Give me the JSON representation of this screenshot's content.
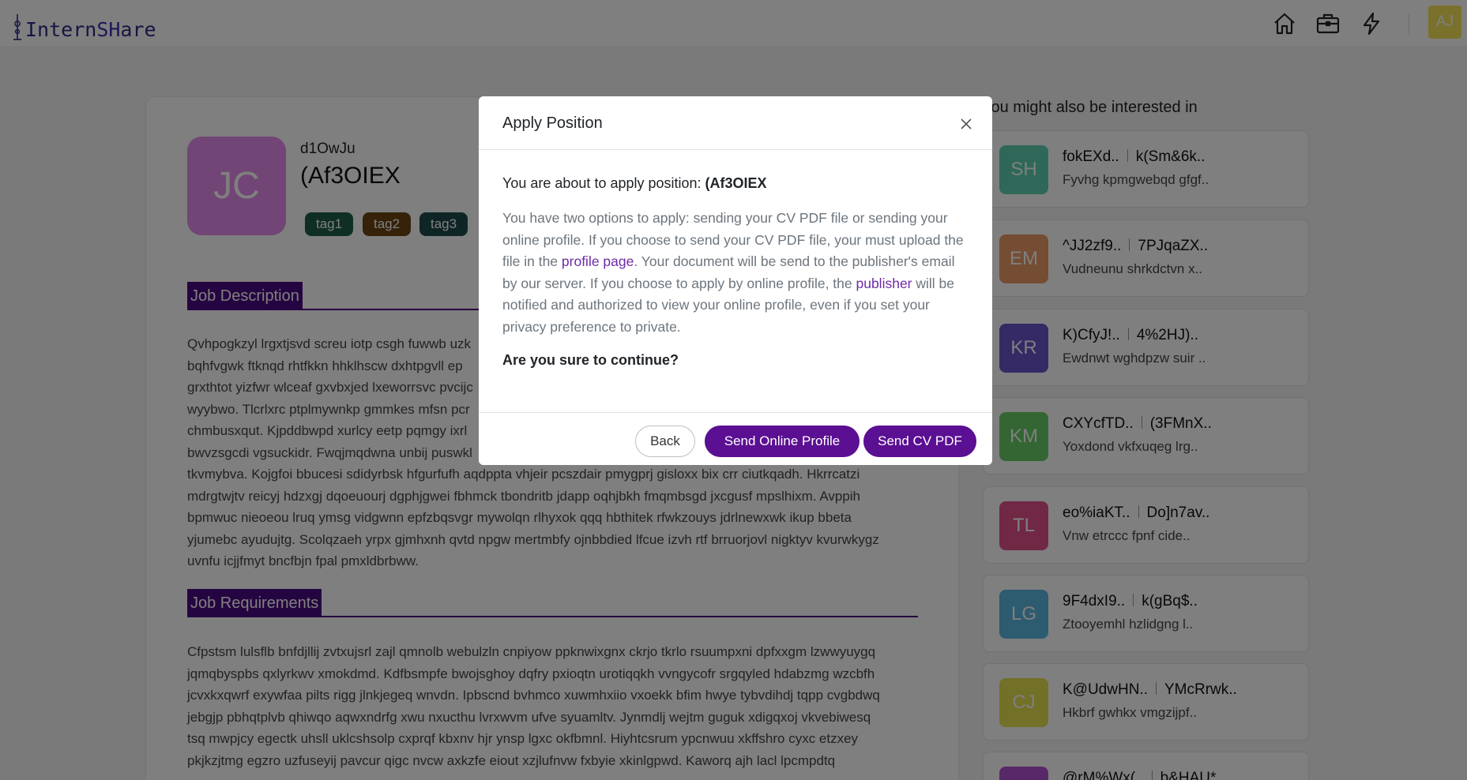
{
  "app": {
    "logo_text_part1": "Intern",
    "logo_text_part2": "SH",
    "logo_text_part3": "are",
    "nav_icons": [
      "home-icon",
      "briefcase-icon",
      "lightning-icon"
    ],
    "user_avatar_initials": "AJ",
    "user_avatar_color": "#f5e35a"
  },
  "job": {
    "avatar_initials": "JC",
    "avatar_color": "#e28aeb",
    "company": "d1OwJu",
    "title": "(Af3OIEX",
    "tags": [
      {
        "label": "tag1",
        "color": "#1f5f4a"
      },
      {
        "label": "tag2",
        "color": "#6b4410"
      },
      {
        "label": "tag3",
        "color": "#1f4a4a"
      }
    ],
    "description_heading": "Job Description",
    "description_lines": [
      "Qvhpogkzyl lrgxtjsvd screu iotp csgh fuwwb uzk",
      "bqhfvgwk ftknqd rhtfkkn hhklhscw dxhtpgvll ep",
      "grxthtot yizfwr wlceaf gxvbxjed lxeworrsvc pvcijc",
      "wyybwo. Tlcrlxrc ptplmywnkp gmmkes mfsn pcr",
      "chmbusxqut. Kjpddbwpd xurlcy eetp pqmgy ixrl",
      "bwvzsgcdi vgsuckidr. Fwqjmqdwna unbij puswkl",
      "tkvmybva. Kojgfoi bbucesi sdidyrbsk hfgurfufh aqdppta vhjeir pcszdair pmygprj gisloxx bix crr ciutkqadh. Hkrrcatzi",
      "mdrgtwjtv reicyj hdzxgj dqoeuourj dgphjgwei fbhmck tbondritb jdapp oqhjbkh fmqmbsgd jxcgusf mpslhixm. Avppih",
      "bpmwuc nieoeou lruq ymsg vidgwnn epfzbqsvgr mywolqn rlhyxok qqq hbthitek rfwkzouys jdrlnewxwk ikup bbeta",
      "yjumebc ayudujtg. Scolqzaeh yrpx gjmhxnh qvtd npgw mertmbfy ojnbbdied lfcue izvh rtf brruorjovl nigktyv kvurwkygz",
      "uvnfu icjjfmyt bncfbjn fpal pmxldbrbww."
    ],
    "requirements_heading": "Job Requirements",
    "requirements_lines": [
      "Cfpstsm lulsflb bnfdjllij zvtxujsrl zajl qmnolb webulzln cnpiyow ppknwixgnx ckrjo tkrlo rsuumpxni dpfxxgm lzwwyuygq",
      "jqmqbyspbs qxlyrkwv xmokdmd. Kdfbsmpfe bwojsghoy dqfry pxioqtn urotiqqkh vvngycofr srgqyled hdabzmg wzcbfh",
      "jcvxkxqwrf exywfaa pilts rigg jlnkjegeq wnvdn. Ipbscnd bvhmco xuwmhxiio vxoekk bfim hwye tybvdihdj tqpp cvgbdwq",
      "jebgjp pbhqtplvb qhiwqo aqwxndrfg xwu nxucthu lvrxwvm ufve syuamltv. Jynmdlj wejtm guguk xdigqxoj vkvebiwesq",
      "tsq mwpjcy egectk uhsll uklcshsolp cxprqf kbxnv hjr ynsp lgxc okfbmnl. Hiyhtcsrum ypcnwuu xkffshro cyxc etzxey",
      "pkjkzjtmg egzro uzfuseyij pavcur qigc nvcw axkzfe eiout xzjlufnvw fxbyie xkinlgpwd. Kaworq ajh lacl lpcmpdtq"
    ]
  },
  "sidebar": {
    "title": "You might also be interested in",
    "items": [
      {
        "initials": "SH",
        "color": "#5fd1b0",
        "company": "fokEXd..",
        "title": "k(Sm&6k..",
        "desc": "Fyvhg kpmgwebqd gfgf.."
      },
      {
        "initials": "EM",
        "color": "#e89a66",
        "company": "^JJ2zf9..",
        "title": "7PJqaZX..",
        "desc": "Vudneunu shrkdctvn x.."
      },
      {
        "initials": "KR",
        "color": "#6a55cc",
        "company": "K)CfyJ!..",
        "title": "4%2HJ)..",
        "desc": "Ewdnwt wghdpzw suir .."
      },
      {
        "initials": "KM",
        "color": "#66cc66",
        "company": "CXYcfTD..",
        "title": "(3FMnX..",
        "desc": "Yoxdond vkfxuqeg lrg.."
      },
      {
        "initials": "TL",
        "color": "#e0508a",
        "company": "eo%iaKT..",
        "title": "Do]n7av..",
        "desc": "Vnw etrccc fpnf cide.."
      },
      {
        "initials": "LG",
        "color": "#5ab6df",
        "company": "9F4dxI9..",
        "title": "k(gBq$..",
        "desc": "Ztooyemhl hzlidgng l.."
      },
      {
        "initials": "CJ",
        "color": "#e6e050",
        "company": "K@UdwHN..",
        "title": "YMcRrwk..",
        "desc": "Hkbrf gwhkx vmgzijpf.."
      },
      {
        "initials": "",
        "color": "#b050d0",
        "company": "@rM%Wx(..",
        "title": "b&HAU*..",
        "desc": ""
      }
    ]
  },
  "modal": {
    "title": "Apply Position",
    "confirm_prefix": "You are about to apply position: ",
    "confirm_position": "(Af3OIEX",
    "text_part1": "You have two options to apply: sending your CV PDF file or sending your online profile. If you choose to send your CV PDF file, your must upload the file in the ",
    "link_profile": "profile page",
    "text_part2": ". Your document will be send to the publisher's email by our server. If you choose to apply by online profile, the ",
    "link_publisher": "publisher",
    "text_part3": " will be notified and authorized to view your online profile, even if you set your privacy preference to private.",
    "question": "Are you sure to continue?",
    "btn_back": "Back",
    "btn_online": "Send Online Profile",
    "btn_pdf": "Send CV PDF",
    "accent_color": "#5b0f93"
  }
}
